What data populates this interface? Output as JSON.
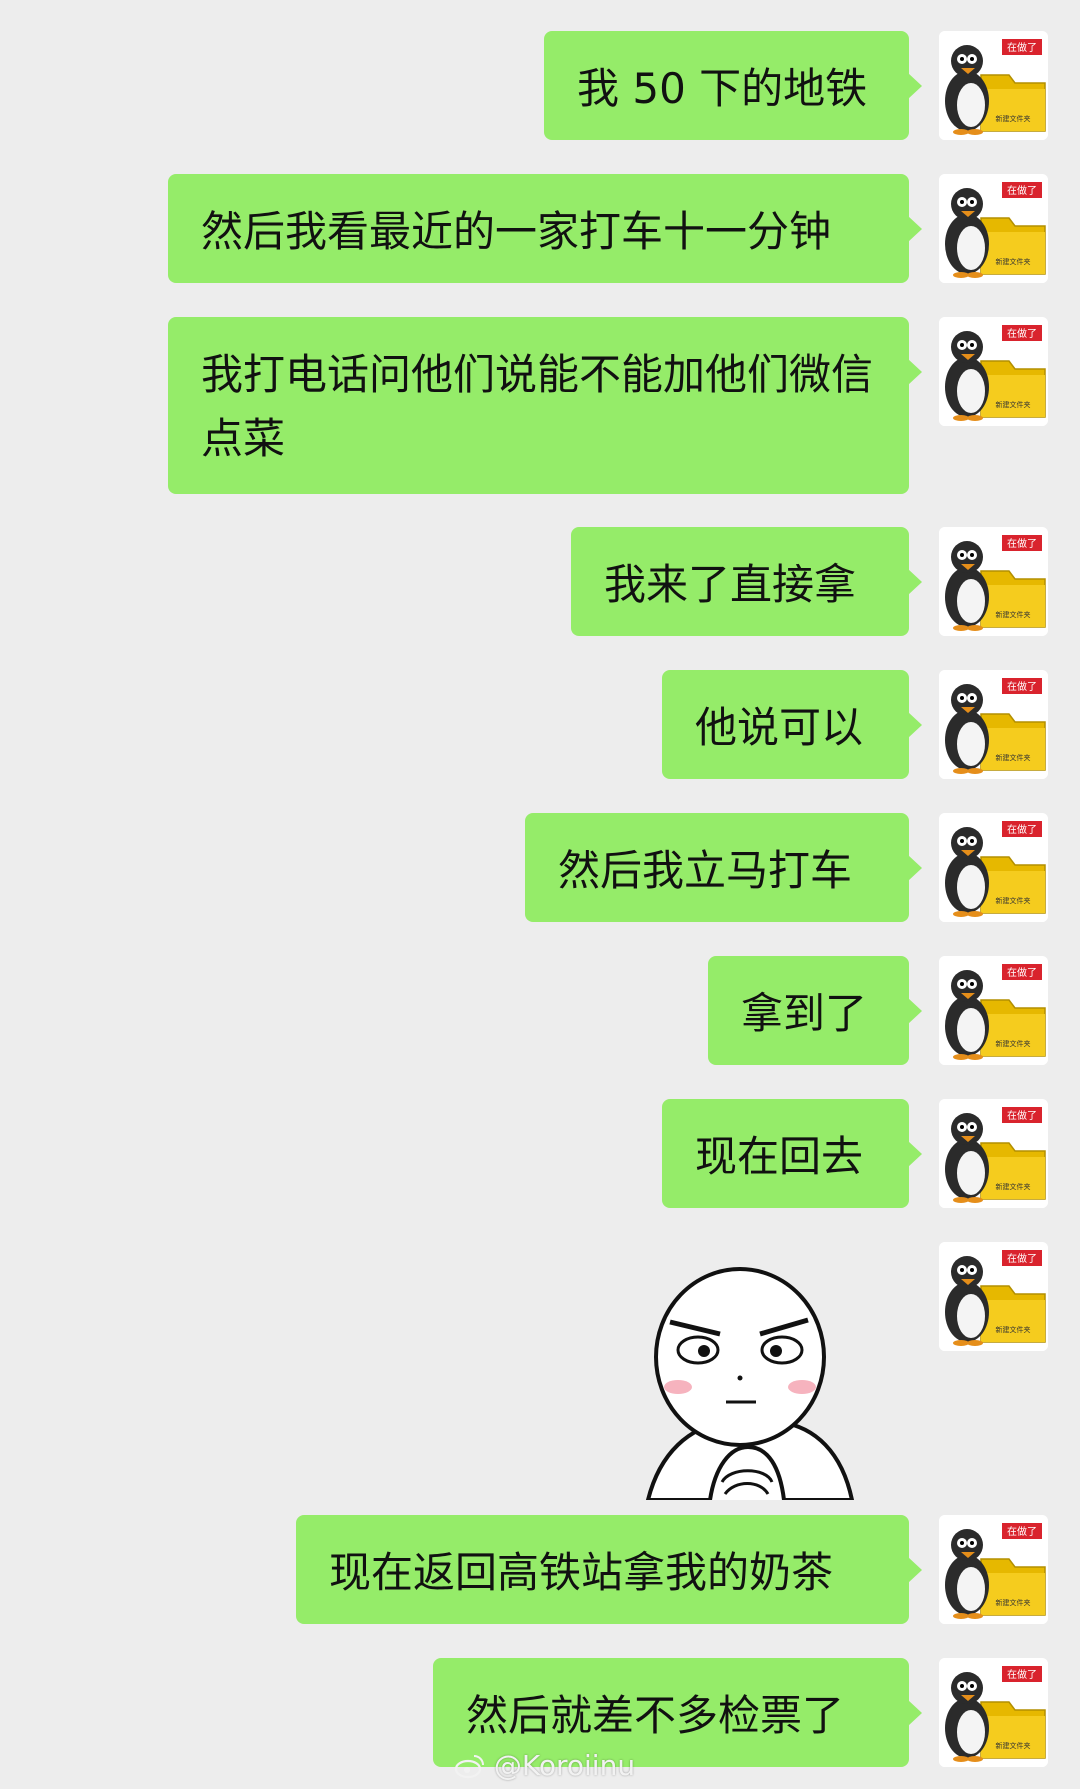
{
  "messages": [
    {
      "text": "我 50 下的地铁"
    },
    {
      "text": "然后我看最近的一家打车十一分钟"
    },
    {
      "text": "我打电话问他们说能不能加他们微信点菜"
    },
    {
      "text": "我来了直接拿"
    },
    {
      "text": "他说可以"
    },
    {
      "text": "然后我立马打车"
    },
    {
      "text": "拿到了"
    },
    {
      "text": "现在回去"
    },
    {
      "sticker": "thinking-face-sticker"
    },
    {
      "text": "现在返回高铁站拿我的奶茶"
    },
    {
      "text": "然后就差不多检票了"
    }
  ],
  "avatar": {
    "badge_text": "在做了",
    "folder_text": "新建文件夹",
    "icon": "penguin-folder-avatar"
  },
  "colors": {
    "background": "#ededed",
    "bubble": "#95ec69",
    "text": "#111111"
  },
  "watermark": "@Koroiinu"
}
